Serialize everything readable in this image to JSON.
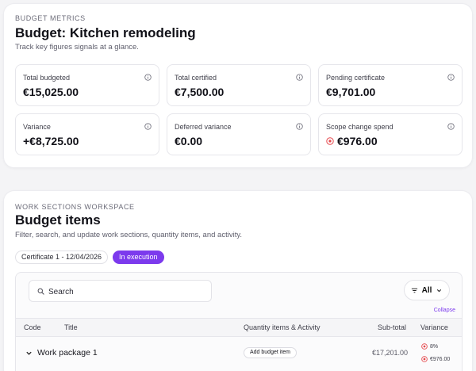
{
  "metrics_card": {
    "eyebrow": "BUDGET METRICS",
    "title": "Budget: Kitchen remodeling",
    "subtitle": "Track key figures signals at a glance.",
    "metrics": [
      {
        "label": "Total budgeted",
        "value": "€15,025.00",
        "icon": "info-icon"
      },
      {
        "label": "Total certified",
        "value": "€7,500.00",
        "icon": "info-icon"
      },
      {
        "label": "Pending certificate",
        "value": "€9,701.00",
        "icon": "info-icon"
      },
      {
        "label": "Variance",
        "value": "+€8,725.00",
        "icon": "info-icon"
      },
      {
        "label": "Deferred variance",
        "value": "€0.00",
        "icon": "info-icon"
      },
      {
        "label": "Scope change spend",
        "value": "€976.00",
        "icon": "info-icon",
        "value_icon": "warning-icon"
      }
    ]
  },
  "workspace": {
    "eyebrow": "WORK SECTIONS WORKSPACE",
    "title": "Budget items",
    "subtitle": "Filter, search, and update work sections, quantity items, and activity.",
    "certificate_chip": "Certificate 1 - 12/04/2026",
    "status_chip": "In execution",
    "search": {
      "placeholder": "Search",
      "icon": "search-icon"
    },
    "filter": {
      "label": "All",
      "icon": "filter-icon"
    },
    "collapse_label": "Collapse",
    "table": {
      "headers": [
        "Code",
        "Title",
        "Quantity items & Activity",
        "Sub-total",
        "Variance"
      ],
      "rows": [
        {
          "title": "Work package 1",
          "action_label": "Add budget item",
          "subtotal": "€17,201.00",
          "variance_percent": "8%",
          "variance_amount": "€976.00"
        }
      ]
    }
  },
  "colors": {
    "accent": "#7c3aed",
    "warning": "#e5484d",
    "text": "#16161d",
    "muted": "#6b6b78"
  }
}
